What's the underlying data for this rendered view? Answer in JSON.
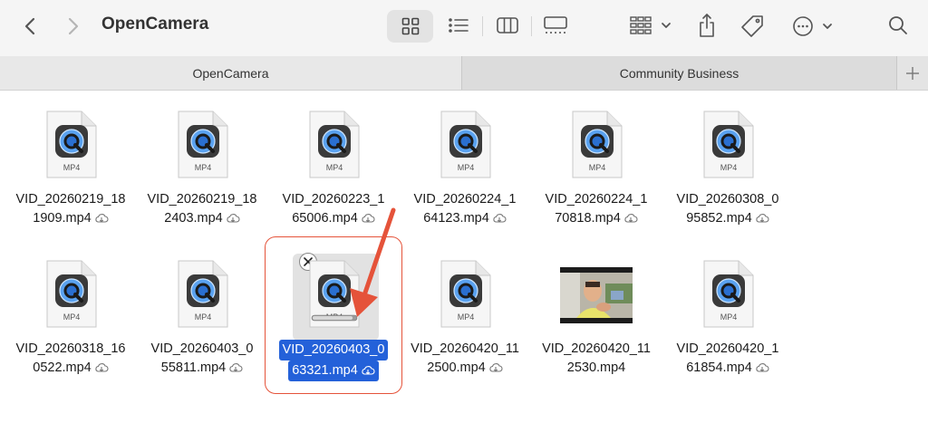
{
  "window": {
    "title": "OpenCamera"
  },
  "tabs": [
    {
      "label": "OpenCamera",
      "active": true
    },
    {
      "label": "Community Business",
      "active": false
    }
  ],
  "files": [
    {
      "line1": "VID_20260219_18",
      "line2": "1909.mp4",
      "type_label": "MP4",
      "kind": "quicktime",
      "cloud": true
    },
    {
      "line1": "VID_20260219_18",
      "line2": "2403.mp4",
      "type_label": "MP4",
      "kind": "quicktime",
      "cloud": true
    },
    {
      "line1": "VID_20260223_1",
      "line2": "65006.mp4",
      "type_label": "MP4",
      "kind": "quicktime",
      "cloud": true
    },
    {
      "line1": "VID_20260224_1",
      "line2": "64123.mp4",
      "type_label": "MP4",
      "kind": "quicktime",
      "cloud": true
    },
    {
      "line1": "VID_20260224_1",
      "line2": "70818.mp4",
      "type_label": "MP4",
      "kind": "quicktime",
      "cloud": true
    },
    {
      "line1": "VID_20260308_0",
      "line2": "95852.mp4",
      "type_label": "MP4",
      "kind": "quicktime",
      "cloud": true
    },
    {
      "line1": "VID_20260318_16",
      "line2": "0522.mp4",
      "type_label": "MP4",
      "kind": "quicktime",
      "cloud": true
    },
    {
      "line1": "VID_20260403_0",
      "line2": "55811.mp4",
      "type_label": "MP4",
      "kind": "quicktime",
      "cloud": true
    },
    {
      "line1": "VID_20260403_0",
      "line2": "63321.mp4",
      "type_label": "MP4",
      "kind": "quicktime",
      "cloud": true,
      "selected": true,
      "downloading": true
    },
    {
      "line1": "VID_20260420_11",
      "line2": "2500.mp4",
      "type_label": "MP4",
      "kind": "quicktime",
      "cloud": true
    },
    {
      "line1": "VID_20260420_11",
      "line2": "2530.mp4",
      "type_label": "",
      "kind": "video-thumbnail",
      "cloud": false
    },
    {
      "line1": "VID_20260420_1",
      "line2": "61854.mp4",
      "type_label": "MP4",
      "kind": "quicktime",
      "cloud": true
    }
  ],
  "icons": {
    "back": "chevron-left-icon",
    "forward": "chevron-right-icon",
    "view_icons": "grid-view-icon",
    "view_list": "list-view-icon",
    "view_columns": "column-view-icon",
    "view_gallery": "gallery-view-icon",
    "group": "group-by-icon",
    "share": "share-icon",
    "tag": "tag-icon",
    "more": "more-icon",
    "search": "search-icon",
    "add_tab": "plus-icon"
  },
  "colors": {
    "selection": "#2461d9",
    "annotation": "#e5533a"
  }
}
